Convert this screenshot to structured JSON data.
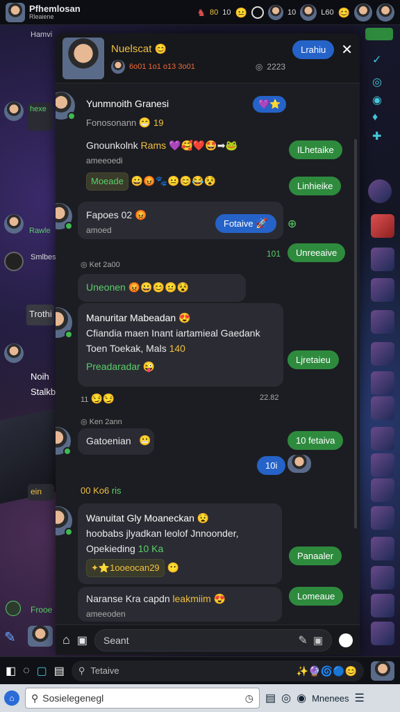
{
  "topbar": {
    "brand": "Pfhemlosan",
    "brand_sub": "Rleaiene",
    "stat1": "80",
    "stat1b": "10",
    "stat2": "10",
    "stat3": "L60"
  },
  "left_panel": {
    "label_top": "Hamvi",
    "label_hexe": "hexe",
    "label_rawle": "Rawle",
    "label_sm": "Smlbes",
    "label_troth": "Trothi",
    "label_noih": "Noih",
    "label_stack": "Stalkb",
    "label_ein": "ein",
    "label_frooe": "Frooe"
  },
  "chat": {
    "header_title": "Nuelscat",
    "header_sub": "6o01 1o1 o13 3o01",
    "header_count": "2223",
    "header_button": "Lrahiu",
    "messages": {
      "m1_name": "Yunmnoith Granesi",
      "m1_sub": "Fonosonann",
      "m1_sub_num": "19",
      "m1_line2": "Gnounkolnk",
      "m1_line2_gold": "Rams",
      "m1_line3": "ameeoedi",
      "m1_pill": "Moeade",
      "m1_btn1": "ILhetaike",
      "m1_btn2": "Linhieike",
      "m2_name": "Fapoes 02",
      "m2_sub": "amoed",
      "m2_btn": "Fotaive",
      "m3_btn": "Unreeaive",
      "m3_num": "101",
      "ts1": "Ket 2a00",
      "m4_text": "Uneonen",
      "m5_name": "Manuritar Mabeadan",
      "m5_line2": "Cfiandia maen Inant iartamieal Gaedank",
      "m5_line3": "Toen Toekak, Mals",
      "m5_line3_gold": "140",
      "m5_green": "Preadaradar",
      "m5_btn": "Ljretaieu",
      "ts2_left": "11",
      "ts2_right": "22.82",
      "ts3": "Ken 2ann",
      "m6_text": "Gatoenian",
      "m6_btn": "10 fetaiva",
      "m6_blue": "10i",
      "section_label": "00 Ko6",
      "section_label_b": "ris",
      "m7_name": "Wanuitat Gly Moaneckan",
      "m7_line2": "hoobabs jlyadkan leolof Jnnoonder,",
      "m7_line3": "Opekieding",
      "m7_line3_green": "10 Ka",
      "m7_pill": "1ooeocan29",
      "m7_btn": "Panaaler",
      "m8_name": "Naranse Kra capdn",
      "m8_name_gold": "leakmiim",
      "m8_sub": "ameeoden",
      "m8_btn": "Lomeaue"
    }
  },
  "composer": {
    "placeholder": "Seant"
  },
  "navbar": {
    "search_placeholder": "Tetaive"
  },
  "taskbar": {
    "search_text": "Sosielegenegl",
    "label": "Mnenees"
  },
  "colors": {
    "accent_green": "#2e8b3e",
    "accent_blue": "#2563c9",
    "gold": "#f0c040"
  }
}
